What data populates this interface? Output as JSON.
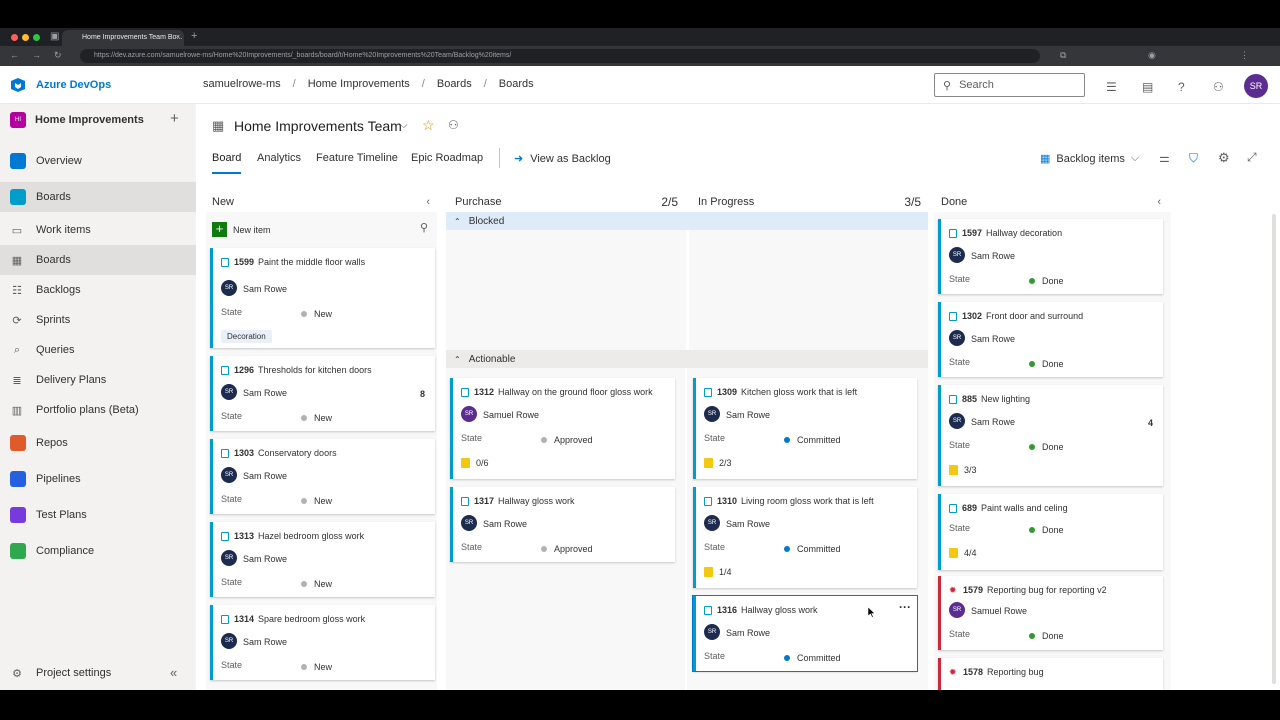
{
  "browser": {
    "tab_title": "Home Improvements Team Bo...",
    "url": "https://dev.azure.com/samuelrowe-ms/Home%20Improvements/_boards/board/t/Home%20Improvements%20Team/Backlog%20items/"
  },
  "header": {
    "product": "Azure DevOps",
    "breadcrumb": [
      "samuelrowe-ms",
      "Home Improvements",
      "Boards",
      "Boards"
    ],
    "search_placeholder": "Search",
    "user_initials": "SR"
  },
  "sidebar": {
    "project_initials": "HI",
    "project_name": "Home Improvements",
    "items": [
      {
        "label": "Overview",
        "icon": "overview-icon",
        "color": "#0078d4"
      },
      {
        "label": "Boards",
        "icon": "boards-icon",
        "color": "#009ccc"
      },
      {
        "label": "Work items",
        "icon": "work-items-icon"
      },
      {
        "label": "Boards",
        "icon": "board-grid-icon"
      },
      {
        "label": "Backlogs",
        "icon": "backlogs-icon"
      },
      {
        "label": "Sprints",
        "icon": "sprints-icon"
      },
      {
        "label": "Queries",
        "icon": "queries-icon"
      },
      {
        "label": "Delivery Plans",
        "icon": "delivery-plans-icon"
      },
      {
        "label": "Portfolio plans (Beta)",
        "icon": "portfolio-icon"
      },
      {
        "label": "Repos",
        "icon": "repos-icon",
        "color": "#e05b2b"
      },
      {
        "label": "Pipelines",
        "icon": "pipelines-icon",
        "color": "#2560e0"
      },
      {
        "label": "Test Plans",
        "icon": "test-plans-icon",
        "color": "#773adc"
      },
      {
        "label": "Compliance",
        "icon": "compliance-icon",
        "color": "#2fa84f"
      }
    ],
    "settings_label": "Project settings"
  },
  "board": {
    "team": "Home Improvements Team",
    "tabs": [
      "Board",
      "Analytics",
      "Feature Timeline",
      "Epic Roadmap"
    ],
    "view_as_backlog": "View as Backlog",
    "backlog_selector": "Backlog items",
    "columns": [
      {
        "name": "New",
        "limit": ""
      },
      {
        "name": "Purchase",
        "limit": "2/5"
      },
      {
        "name": "In Progress",
        "limit": "3/5"
      },
      {
        "name": "Done",
        "limit": ""
      }
    ],
    "new_item_label": "New item",
    "swimlanes": [
      "Blocked",
      "Actionable"
    ],
    "state_label": "State",
    "new_cards": [
      {
        "id": "1599",
        "title": "Paint the middle floor walls",
        "assignee": "Sam Rowe",
        "initials": "SR",
        "state": "New",
        "tag": "Decoration"
      },
      {
        "id": "1296",
        "title": "Thresholds for kitchen doors",
        "assignee": "Sam Rowe",
        "initials": "SR",
        "state": "New",
        "count": "8"
      },
      {
        "id": "1303",
        "title": "Conservatory doors",
        "assignee": "Sam Rowe",
        "initials": "SR",
        "state": "New"
      },
      {
        "id": "1313",
        "title": "Hazel bedroom gloss work",
        "assignee": "Sam Rowe",
        "initials": "SR",
        "state": "New"
      },
      {
        "id": "1314",
        "title": "Spare bedroom gloss work",
        "assignee": "Sam Rowe",
        "initials": "SR",
        "state": "New"
      }
    ],
    "purchase_cards": [
      {
        "id": "1312",
        "title": "Hallway on the ground floor gloss work",
        "assignee": "Samuel Rowe",
        "initials": "SR",
        "state": "Approved",
        "tasks": "0/6"
      },
      {
        "id": "1317",
        "title": "Hallway gloss work",
        "assignee": "Sam Rowe",
        "initials": "SR",
        "state": "Approved"
      }
    ],
    "progress_cards": [
      {
        "id": "1309",
        "title": "Kitchen gloss work that is left",
        "assignee": "Sam Rowe",
        "initials": "SR",
        "state": "Committed",
        "tasks": "2/3"
      },
      {
        "id": "1310",
        "title": "Living room gloss work that is left",
        "assignee": "Sam Rowe",
        "initials": "SR",
        "state": "Committed",
        "tasks": "1/4"
      },
      {
        "id": "1316",
        "title": "Hallway gloss work",
        "assignee": "Sam Rowe",
        "initials": "SR",
        "state": "Committed"
      }
    ],
    "done_cards": [
      {
        "id": "1597",
        "title": "Hallway decoration",
        "assignee": "Sam Rowe",
        "initials": "SR",
        "state": "Done"
      },
      {
        "id": "1302",
        "title": "Front door and surround",
        "assignee": "Sam Rowe",
        "initials": "SR",
        "state": "Done"
      },
      {
        "id": "885",
        "title": "New lighting",
        "assignee": "Sam Rowe",
        "initials": "SR",
        "state": "Done",
        "count": "4",
        "tasks": "3/3"
      },
      {
        "id": "689",
        "title": "Paint walls and celing",
        "state": "Done",
        "tasks": "4/4"
      },
      {
        "id": "1579",
        "title": "Reporting bug for reporting v2",
        "assignee": "Samuel Rowe",
        "initials": "SR",
        "state": "Done"
      },
      {
        "id": "1578",
        "title": "Reporting bug"
      }
    ]
  },
  "colors": {
    "accent": "#0078d4",
    "new_state": "#b2b2b2",
    "approved_state": "#b2b2b2",
    "committed_state": "#007acc",
    "done_state": "#339933",
    "story_border": "#009ccc",
    "bug_border": "#cc293d",
    "swimlane_bg": "#deecf9"
  }
}
